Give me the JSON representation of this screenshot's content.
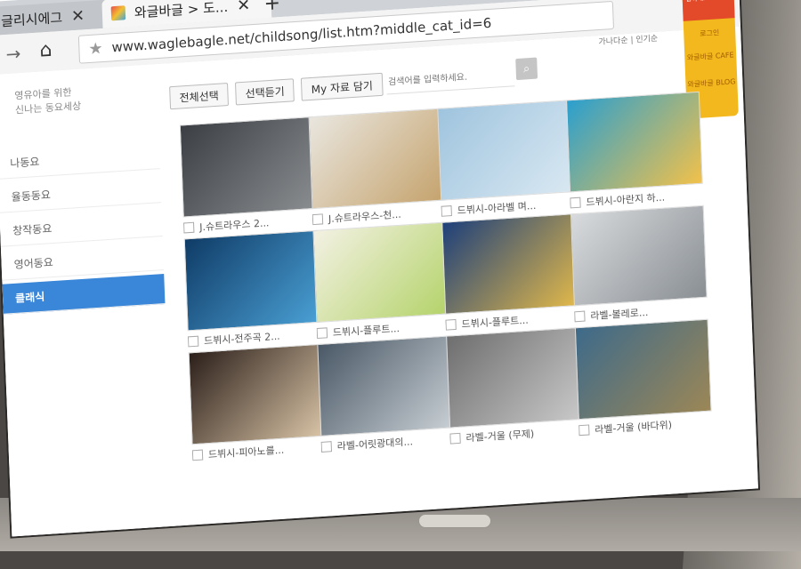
{
  "browser": {
    "tabs": [
      {
        "label": "글리시에그",
        "close": "✕"
      },
      {
        "label": "와글바글 > 도...",
        "close": "✕"
      }
    ],
    "new_tab": "+",
    "url": "www.waglebagle.net/childsong/list.htm?middle_cat_id=6"
  },
  "page": {
    "top_links": "가나다순  |  인기순",
    "sidebar": {
      "subtitle_line1": "영유아를 위한",
      "subtitle_line2": "신나는 동요세상",
      "items": [
        {
          "label": "나동요"
        },
        {
          "label": "율동동요"
        },
        {
          "label": "창작동요"
        },
        {
          "label": "영어동요"
        },
        {
          "label": "클래식"
        }
      ]
    },
    "toolbar": {
      "select_all": "전체선택",
      "listen_selected": "선택듣기",
      "save_my": "My 자료 담기",
      "search_placeholder": "검색어를 입력하세요."
    },
    "banner": {
      "top_text": "와글바글 유료회원 되고 실컷 이용하세요",
      "item1": "로그인",
      "item2": "와글바글 CAFE",
      "item3": "와글바글 BLOG"
    },
    "videos": [
      {
        "title": "J.슈트라우스 2...",
        "colors": [
          "#3b3f44",
          "#8a8d90"
        ]
      },
      {
        "title": "J.슈트라우스-천...",
        "colors": [
          "#e9e6df",
          "#c5a36d"
        ]
      },
      {
        "title": "드뷔시-아라벨 며...",
        "colors": [
          "#9fc4de",
          "#d9e8f2"
        ]
      },
      {
        "title": "드뷔시-아란지 하...",
        "colors": [
          "#2a9fcf",
          "#f2c14a"
        ]
      },
      {
        "title": "드뷔시-전주곡 2...",
        "colors": [
          "#0f3b66",
          "#4aa0d5"
        ]
      },
      {
        "title": "드뷔시-플루트...",
        "colors": [
          "#f3f1e3",
          "#b4d36a"
        ]
      },
      {
        "title": "드뷔시-플루트...",
        "colors": [
          "#1d3f7a",
          "#e2b94a"
        ]
      },
      {
        "title": "라벨-볼레로...",
        "colors": [
          "#d8dbdd",
          "#8a8f94"
        ]
      },
      {
        "title": "드뷔시-피아노를...",
        "colors": [
          "#2b1f1a",
          "#d9c4a6"
        ]
      },
      {
        "title": "라벨-어릿광대의...",
        "colors": [
          "#4a5866",
          "#c8cfd4"
        ]
      },
      {
        "title": "라벨-거울 (무제)",
        "colors": [
          "#6e6e6e",
          "#c9c9c9"
        ]
      },
      {
        "title": "라벨-거울 (바다위)",
        "colors": [
          "#3d6a8a",
          "#9c8756"
        ]
      }
    ]
  }
}
